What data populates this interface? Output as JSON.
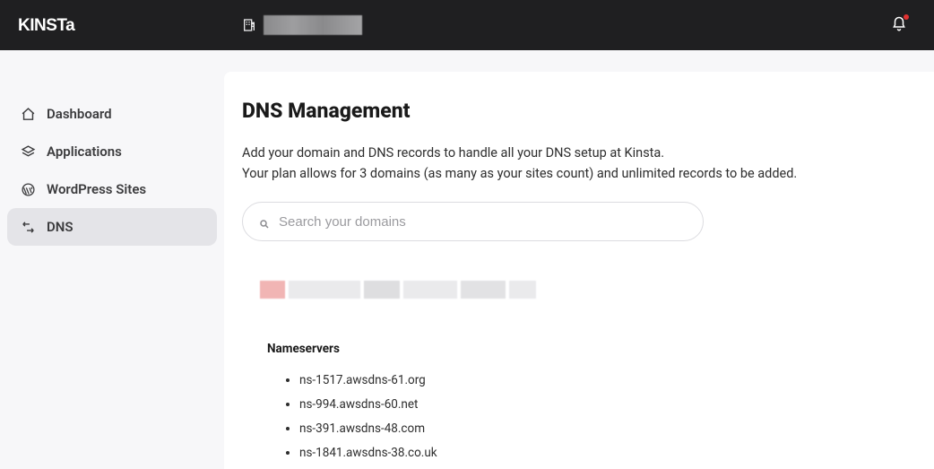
{
  "brand": "KINSTA",
  "sidebar": {
    "items": [
      {
        "label": "Dashboard"
      },
      {
        "label": "Applications"
      },
      {
        "label": "WordPress Sites"
      },
      {
        "label": "DNS"
      }
    ]
  },
  "page": {
    "title": "DNS Management",
    "desc_line1": "Add your domain and DNS records to handle all your DNS setup at Kinsta.",
    "desc_line2": "Your plan allows for 3 domains (as many as your sites count) and unlimited records to be added.",
    "search_placeholder": "Search your domains"
  },
  "nameservers": {
    "heading": "Nameservers",
    "items": [
      "ns-1517.awsdns-61.org",
      "ns-994.awsdns-60.net",
      "ns-391.awsdns-48.com",
      "ns-1841.awsdns-38.co.uk"
    ]
  }
}
